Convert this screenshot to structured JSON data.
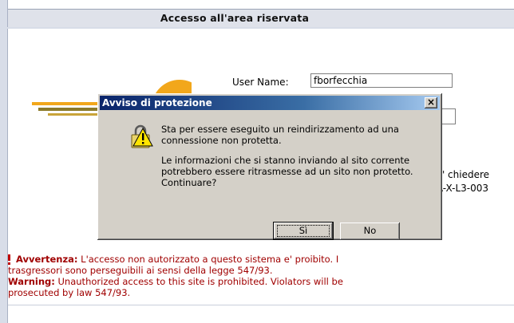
{
  "page": {
    "title": "Accesso all'area riservata",
    "username_label": "User Name:",
    "username_value": "fborfecchia",
    "side_text_1": "uo' chiedere",
    "side_text_2": "SA-X-L3-003"
  },
  "warning": {
    "it_label": "Avvertenza:",
    "it_text_1": " L'accesso non autorizzato a questo sistema e' proibito. I",
    "it_text_2": "trasgressori sono perseguibili ai sensi della legge 547/93.",
    "en_label": "Warning:",
    "en_text_1": " Unauthorized access to this site is prohibited. Violators will be",
    "en_text_2": "prosecuted by law 547/93.",
    "color": "#a00000"
  },
  "dialog": {
    "title": "Avviso di protezione",
    "close_glyph": "×",
    "message_1": "Sta per essere eseguito un reindirizzamento ad una",
    "message_2": "connessione non protetta.",
    "message_3": "Le informazioni che si stanno inviando al sito corrente",
    "message_4": "potrebbero essere ritrasmesse ad un sito non protetto.",
    "message_5": "Continuare?",
    "yes_label": "Sì",
    "no_label": "No",
    "icon": "warning-lock-icon"
  },
  "colors": {
    "titlebar_start": "#0a246a",
    "titlebar_end": "#a6caf0",
    "dialog_face": "#d4d0c8",
    "header_bg": "#dfe2ea"
  }
}
